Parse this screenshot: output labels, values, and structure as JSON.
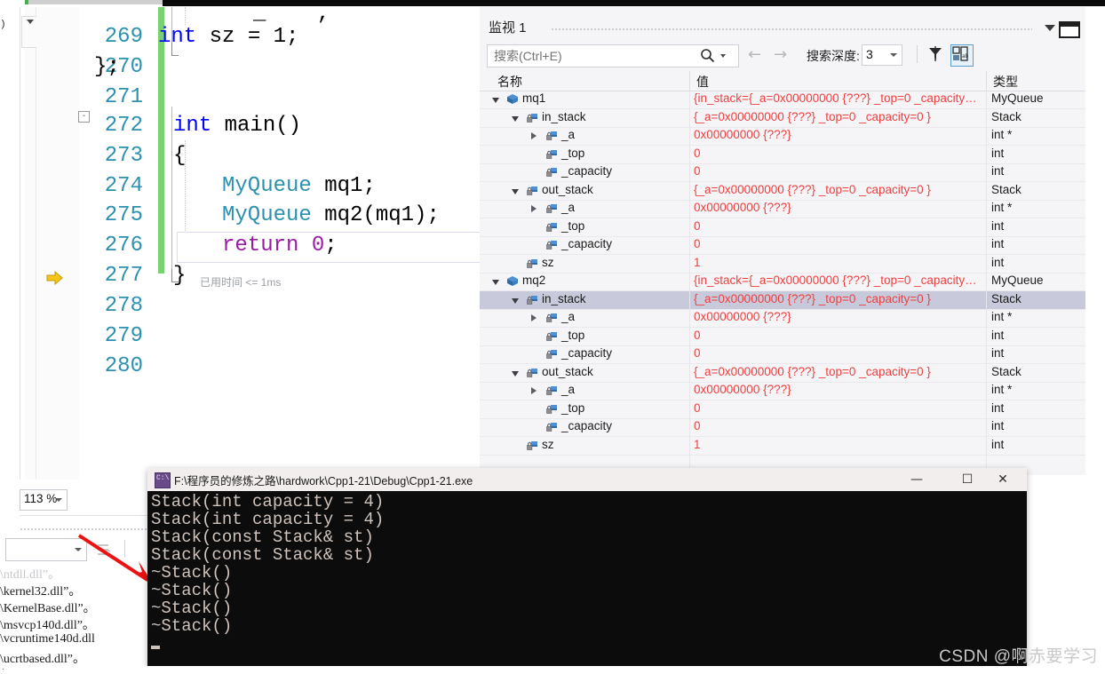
{
  "editor": {
    "lines": [
      {
        "num": "269",
        "code": "    int sz = 1;"
      },
      {
        "num": "270",
        "code": "};"
      },
      {
        "num": "271",
        "code": ""
      },
      {
        "num": "272",
        "code": "int main()"
      },
      {
        "num": "273",
        "code": "{"
      },
      {
        "num": "274",
        "code": "    MyQueue mq1;"
      },
      {
        "num": "275",
        "code": "    MyQueue mq2(mq1);"
      },
      {
        "num": "276",
        "code": "    return 0;"
      },
      {
        "num": "277",
        "code": "}"
      },
      {
        "num": "278",
        "code": ""
      },
      {
        "num": "279",
        "code": ""
      },
      {
        "num": "280",
        "code": ""
      }
    ],
    "elapsed_label": "已用时间 <= 1ms",
    "zoom_level": "113 %",
    "collapse_glyph": "-"
  },
  "watch": {
    "title": "监视 1",
    "search": {
      "placeholder": "搜索(Ctrl+E)",
      "value": ""
    },
    "depth_label": "搜索深度:",
    "depth_value": "3",
    "columns": {
      "name": "名称",
      "value": "值",
      "type": "类型"
    },
    "rows": [
      {
        "indent": 0,
        "twisty": "open",
        "icon": "object",
        "name": "mq1",
        "value": "{in_stack={_a=0x00000000 {???} _top=0 _capacity…",
        "type": "MyQueue",
        "selected": false
      },
      {
        "indent": 1,
        "twisty": "open",
        "icon": "field",
        "name": "in_stack",
        "value": "{_a=0x00000000 {???} _top=0 _capacity=0 }",
        "type": "Stack",
        "selected": false
      },
      {
        "indent": 2,
        "twisty": "closed",
        "icon": "field",
        "name": "_a",
        "value": "0x00000000 {???}",
        "type": "int *",
        "selected": false
      },
      {
        "indent": 2,
        "twisty": "none",
        "icon": "field",
        "name": "_top",
        "value": "0",
        "type": "int",
        "selected": false
      },
      {
        "indent": 2,
        "twisty": "none",
        "icon": "field",
        "name": "_capacity",
        "value": "0",
        "type": "int",
        "selected": false
      },
      {
        "indent": 1,
        "twisty": "open",
        "icon": "field",
        "name": "out_stack",
        "value": "{_a=0x00000000 {???} _top=0 _capacity=0 }",
        "type": "Stack",
        "selected": false
      },
      {
        "indent": 2,
        "twisty": "closed",
        "icon": "field",
        "name": "_a",
        "value": "0x00000000 {???}",
        "type": "int *",
        "selected": false
      },
      {
        "indent": 2,
        "twisty": "none",
        "icon": "field",
        "name": "_top",
        "value": "0",
        "type": "int",
        "selected": false
      },
      {
        "indent": 2,
        "twisty": "none",
        "icon": "field",
        "name": "_capacity",
        "value": "0",
        "type": "int",
        "selected": false
      },
      {
        "indent": 1,
        "twisty": "none",
        "icon": "field",
        "name": "sz",
        "value": "1",
        "type": "int",
        "selected": false
      },
      {
        "indent": 0,
        "twisty": "open",
        "icon": "object",
        "name": "mq2",
        "value": "{in_stack={_a=0x00000000 {???} _top=0 _capacity…",
        "type": "MyQueue",
        "selected": false
      },
      {
        "indent": 1,
        "twisty": "open",
        "icon": "field",
        "name": "in_stack",
        "value": "{_a=0x00000000 {???} _top=0 _capacity=0 }",
        "type": "Stack",
        "selected": true
      },
      {
        "indent": 2,
        "twisty": "closed",
        "icon": "field",
        "name": "_a",
        "value": "0x00000000 {???}",
        "type": "int *",
        "selected": false
      },
      {
        "indent": 2,
        "twisty": "none",
        "icon": "field",
        "name": "_top",
        "value": "0",
        "type": "int",
        "selected": false
      },
      {
        "indent": 2,
        "twisty": "none",
        "icon": "field",
        "name": "_capacity",
        "value": "0",
        "type": "int",
        "selected": false
      },
      {
        "indent": 1,
        "twisty": "open",
        "icon": "field",
        "name": "out_stack",
        "value": "{_a=0x00000000 {???} _top=0 _capacity=0 }",
        "type": "Stack",
        "selected": false
      },
      {
        "indent": 2,
        "twisty": "closed",
        "icon": "field",
        "name": "_a",
        "value": "0x00000000 {???}",
        "type": "int *",
        "selected": false
      },
      {
        "indent": 2,
        "twisty": "none",
        "icon": "field",
        "name": "_top",
        "value": "0",
        "type": "int",
        "selected": false
      },
      {
        "indent": 2,
        "twisty": "none",
        "icon": "field",
        "name": "_capacity",
        "value": "0",
        "type": "int",
        "selected": false
      },
      {
        "indent": 1,
        "twisty": "none",
        "icon": "field",
        "name": "sz",
        "value": "1",
        "type": "int",
        "selected": false
      }
    ]
  },
  "output_pane": {
    "dll_lines": [
      "\\ntdll.dll”。",
      "\\kernel32.dll”。",
      "\\KernelBase.dll”。",
      "\\msvcp140d.dll”。",
      "\\vcruntime140d.dll",
      "\\ucrtbased.dll”。"
    ]
  },
  "console": {
    "title": "F:\\程序员的修炼之路\\hardwork\\Cpp1-21\\Debug\\Cpp1-21.exe",
    "minimize_label": "—",
    "maximize_label": "☐",
    "close_label": "✕",
    "lines": [
      "Stack(int capacity = 4)",
      "Stack(int capacity = 4)",
      "Stack(const Stack& st)",
      "Stack(const Stack& st)",
      "~Stack()",
      "~Stack()",
      "~Stack()",
      "~Stack()"
    ]
  },
  "watermark": "CSDN @啊赤要学习",
  "colors": {
    "value_red": "#ef3f3f",
    "line_number_blue": "#2b91af",
    "keyword_blue": "#0000ff",
    "changebar_green": "#76d36f",
    "selection": "#c8cadb"
  }
}
